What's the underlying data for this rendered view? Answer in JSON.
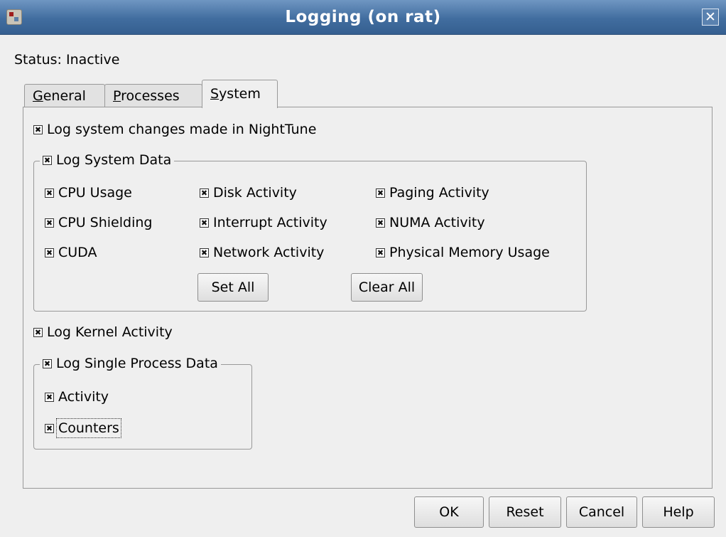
{
  "window": {
    "title": "Logging (on rat)",
    "close_glyph": "✕"
  },
  "status_text": "Status: Inactive",
  "tabs": [
    {
      "pre": "",
      "ul": "G",
      "post": "eneral"
    },
    {
      "pre": "",
      "ul": "P",
      "post": "rocesses"
    },
    {
      "pre": "",
      "ul": "S",
      "post": "ystem"
    }
  ],
  "active_tab": "System",
  "check_glyph": "✖",
  "log_system_changes": "Log system changes made in NightTune",
  "system_data": {
    "title": "Log System Data",
    "items": [
      "CPU Usage",
      "Disk Activity",
      "Paging Activity",
      "CPU Shielding",
      "Interrupt Activity",
      "NUMA Activity",
      "CUDA",
      "Network Activity",
      "Physical Memory Usage"
    ],
    "set_all": "Set All",
    "clear_all": "Clear All"
  },
  "log_kernel": "Log Kernel Activity",
  "single_process": {
    "title": "Log Single Process Data",
    "items": [
      "Activity",
      "Counters"
    ]
  },
  "buttons": {
    "ok": "OK",
    "reset": "Reset",
    "cancel": "Cancel",
    "help": "Help"
  }
}
